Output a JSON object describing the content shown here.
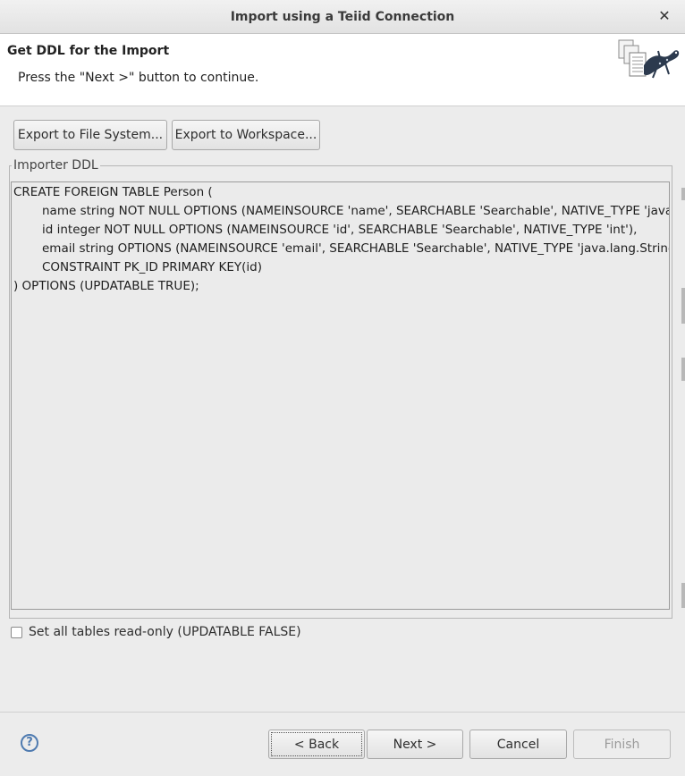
{
  "window": {
    "title": "Import using a Teiid Connection",
    "close_glyph": "✕"
  },
  "banner": {
    "heading": "Get DDL for the Import",
    "message": "Press the \"Next >\" button to continue.",
    "icon": "wizard-import-icon"
  },
  "toolbar": {
    "export_file_label": "Export to File System...",
    "export_workspace_label": "Export to Workspace..."
  },
  "ddl_group": {
    "legend": "Importer DDL",
    "lines": [
      "CREATE FOREIGN TABLE Person (",
      "\tname string NOT NULL OPTIONS (NAMEINSOURCE 'name', SEARCHABLE 'Searchable', NATIVE_TYPE 'java.lang.String'),",
      "\tid integer NOT NULL OPTIONS (NAMEINSOURCE 'id', SEARCHABLE 'Searchable', NATIVE_TYPE 'int'),",
      "\temail string OPTIONS (NAMEINSOURCE 'email', SEARCHABLE 'Searchable', NATIVE_TYPE 'java.lang.String'),",
      "\tCONSTRAINT PK_ID PRIMARY KEY(id)",
      ") OPTIONS (UPDATABLE TRUE);"
    ]
  },
  "readonly_option": {
    "label": "Set all tables read-only (UPDATABLE FALSE)",
    "checked": false
  },
  "footer": {
    "help_glyph": "?",
    "back_label": "< Back",
    "next_label": "Next >",
    "cancel_label": "Cancel",
    "finish_label": "Finish"
  },
  "colors": {
    "dialog_bg": "#ececec",
    "banner_bg": "#ffffff",
    "help_blue": "#4f7bb0"
  }
}
